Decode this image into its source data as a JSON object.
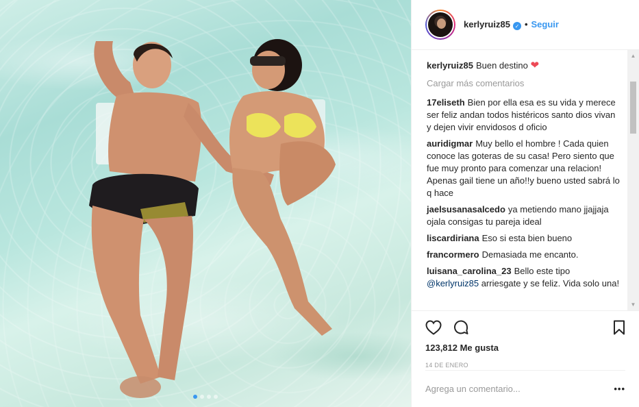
{
  "post": {
    "carousel": {
      "total_slides": 4,
      "active_index": 0
    }
  },
  "header": {
    "username": "kerlyruiz85",
    "verified_icon": "check-icon",
    "separator": "•",
    "follow_label": "Seguir"
  },
  "caption": {
    "username": "kerlyruiz85",
    "text": "Buen destino",
    "emoji": "❤"
  },
  "load_more_label": "Cargar más comentarios",
  "comments": [
    {
      "username": "17eliseth",
      "text": "Bien por ella esa es su vida y merece ser feliz andan todos histéricos santo dios vivan y dejen vivir envidosos d oficio"
    },
    {
      "username": "auridigmar",
      "text": "Muy bello el hombre ! Cada quien conoce las goteras de su casa! Pero siento que fue muy pronto para comenzar una relacion! Apenas gail tiene un año!!y bueno usted sabrá lo q hace"
    },
    {
      "username": "jaelsusanasalcedo",
      "text": "ya metiendo mano jjajjaja ojala consigas tu pareja ideal"
    },
    {
      "username": "liscardiriana",
      "text": "Eso si esta bien bueno"
    },
    {
      "username": "francormero",
      "text": "Demasiada me encanto."
    },
    {
      "username": "luisana_carolina_23",
      "text_before": "Bello este tipo",
      "mention": "@kerlyruiz85",
      "text_after": "arriesgate y se feliz. Vida solo una!"
    }
  ],
  "actions": {
    "like_icon": "heart-icon",
    "comment_icon": "comment-bubble-icon",
    "save_icon": "bookmark-icon"
  },
  "likes": "123,812 Me gusta",
  "date": "14 DE ENERO",
  "add_comment": {
    "placeholder": "Agrega un comentario...",
    "more_label": "•••"
  },
  "colors": {
    "accent": "#3897f0",
    "text": "#262626",
    "muted": "#999999",
    "heart": "#ed4956",
    "border": "#efefef"
  }
}
